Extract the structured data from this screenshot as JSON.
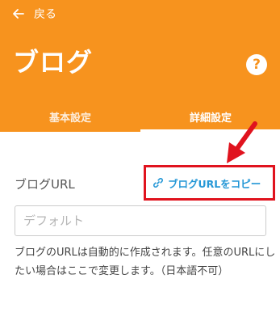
{
  "header": {
    "back_label": "戻る",
    "title": "ブログ",
    "help_symbol": "?",
    "background_color": "#f7931e"
  },
  "tabs": [
    {
      "label": "基本設定",
      "active": false
    },
    {
      "label": "詳細設定",
      "active": true
    }
  ],
  "blog_url": {
    "label": "ブログURL",
    "copy_button_label": "ブログURLをコピー",
    "copy_icon": "link-icon",
    "input_value": "",
    "input_placeholder": "デフォルト",
    "help_text": "ブログのURLは自動的に作成されます。任意のURLにしたい場合はここで変更します。（日本語不可）"
  },
  "annotation": {
    "highlight_color": "#e0131e",
    "icon": "red-arrow-icon"
  }
}
